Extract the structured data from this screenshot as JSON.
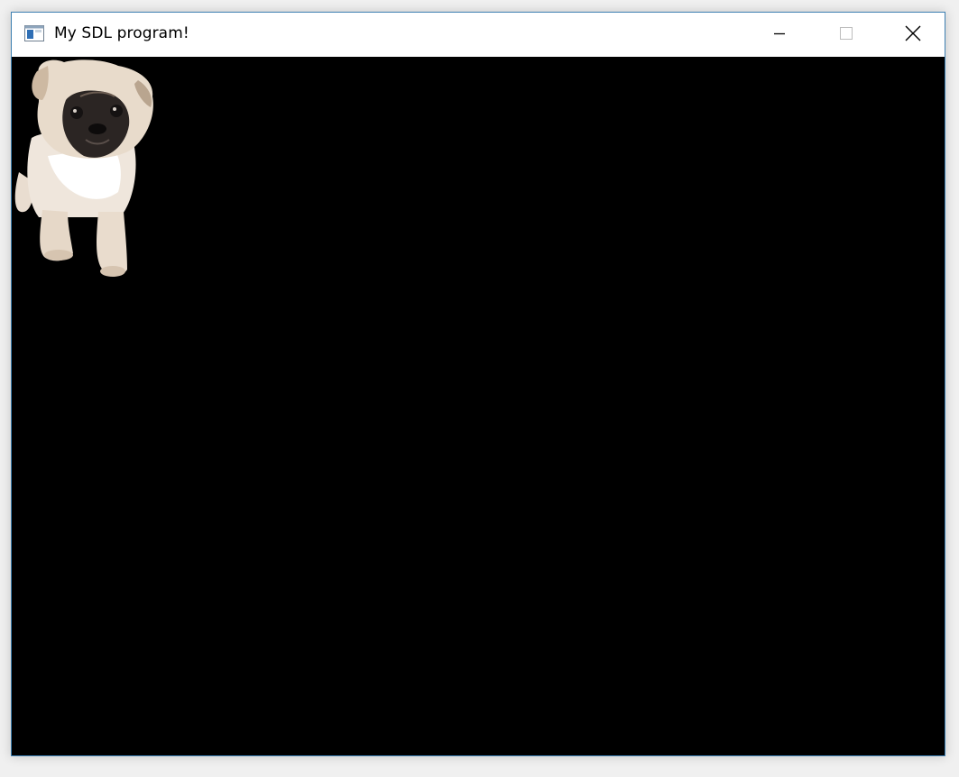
{
  "window": {
    "title": "My SDL program!",
    "app_icon": "sdl-window-icon",
    "controls": {
      "minimize_icon": "minimize-icon",
      "maximize_icon": "maximize-icon",
      "close_icon": "close-icon"
    },
    "accent_color": "#3c7fb1"
  },
  "canvas": {
    "background_color": "#000000",
    "sprite": "pug-puppy-image"
  }
}
